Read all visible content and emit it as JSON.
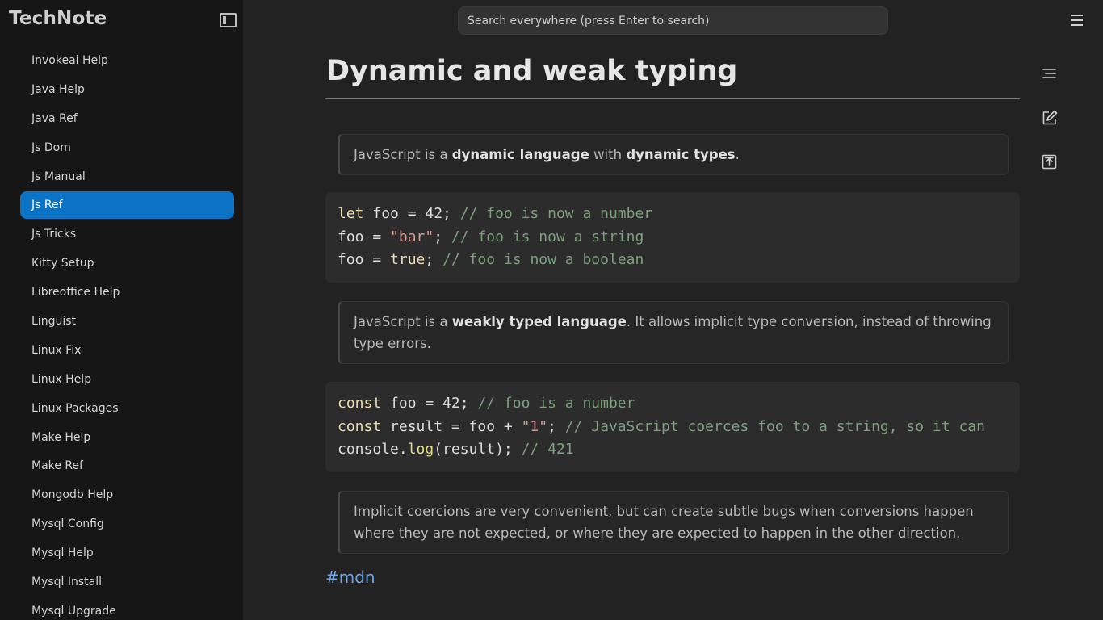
{
  "app": {
    "brand": "TechNote"
  },
  "search": {
    "placeholder": "Search everywhere (press Enter to search)"
  },
  "sidebar": {
    "items": [
      {
        "label": "Invokeai Help"
      },
      {
        "label": "Java Help"
      },
      {
        "label": "Java Ref"
      },
      {
        "label": "Js Dom"
      },
      {
        "label": "Js Manual"
      },
      {
        "label": "Js Ref",
        "active": true
      },
      {
        "label": "Js Tricks"
      },
      {
        "label": "Kitty Setup"
      },
      {
        "label": "Libreoffice Help"
      },
      {
        "label": "Linguist"
      },
      {
        "label": "Linux Fix"
      },
      {
        "label": "Linux Help"
      },
      {
        "label": "Linux Packages"
      },
      {
        "label": "Make Help"
      },
      {
        "label": "Make Ref"
      },
      {
        "label": "Mongodb Help"
      },
      {
        "label": "Mysql Config"
      },
      {
        "label": "Mysql Help"
      },
      {
        "label": "Mysql Install"
      },
      {
        "label": "Mysql Upgrade"
      }
    ]
  },
  "icons": {
    "sidebar_toggle": "sidebar-toggle-icon",
    "menu": "hamburger-menu-icon",
    "outline": "outline-icon",
    "edit": "edit-icon",
    "export": "export-icon"
  },
  "page": {
    "title": "Dynamic and weak typing",
    "callout1": {
      "t1": "JavaScript is a ",
      "b1": "dynamic language",
      "t2": " with ",
      "b2": "dynamic types",
      "t3": "."
    },
    "callout2": {
      "t1": "JavaScript is a ",
      "b1": "weakly typed language",
      "t2": ". It allows implicit type conversion, instead of throwing type errors."
    },
    "callout3": {
      "text": "Implicit coercions are very convenient, but can create subtle bugs when conversions happen where they are not expected, or where they are expected to happen in the other direction."
    },
    "code1": {
      "l1": {
        "kw": "let",
        "a": " foo = 42; ",
        "cm": "// foo is now a number"
      },
      "l2": {
        "a": "foo = ",
        "str": "\"bar\"",
        "b": "; ",
        "cm": "// foo is now a string"
      },
      "l3": {
        "a": "foo = ",
        "kw": "true",
        "b": "; ",
        "cm": "// foo is now a boolean"
      }
    },
    "code2": {
      "l1": {
        "kw": "const",
        "a": " foo = 42; ",
        "cm": "// foo is a number"
      },
      "l2": {
        "kw": "const",
        "a": " result = foo + ",
        "str": "\"1\"",
        "b": "; ",
        "cm": "// JavaScript coerces foo to a string, so it can"
      },
      "l3": {
        "a": "console.",
        "fn": "log",
        "b": "(result); ",
        "cm": "// 421"
      }
    },
    "tag": "#mdn"
  },
  "colors": {
    "accent": "#0b73c6",
    "tag": "#6ca6e8",
    "background": "#222222",
    "sidebar": "#161616"
  }
}
